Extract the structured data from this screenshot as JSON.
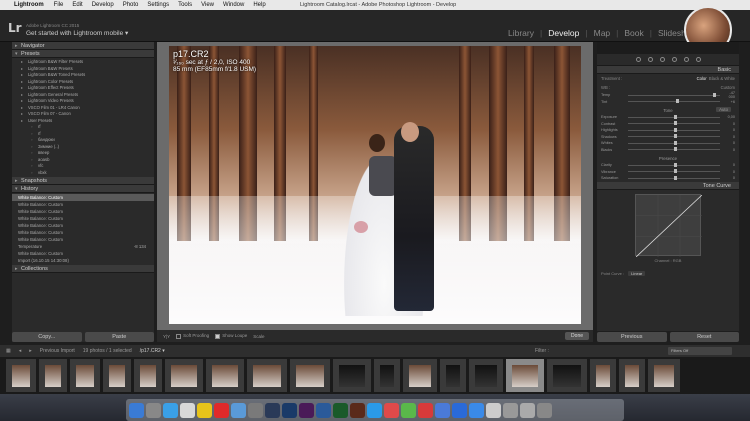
{
  "menubar": {
    "app": "Lightroom",
    "items": [
      "File",
      "Edit",
      "Develop",
      "Photo",
      "Settings",
      "Tools",
      "View",
      "Window",
      "Help"
    ],
    "window_title": "Lightroom Catalog.lrcat - Adobe Photoshop Lightroom - Develop"
  },
  "identity": {
    "logo": "Lr",
    "version": "Adobe Lightroom CC 2015",
    "tagline": "Get started with Lightroom mobile ▾"
  },
  "modules": {
    "items": [
      "Library",
      "Develop",
      "Map",
      "Book",
      "Slideshow"
    ],
    "active": "Develop"
  },
  "left_panel": {
    "navigator": "Navigator",
    "presets_header": "Presets",
    "presets": [
      "Lightroom B&W Filter Presets",
      "Lightroom B&W Presets",
      "Lightroom B&W Toned Presets",
      "Lightroom Color Presets",
      "Lightroom Effect Presets",
      "Lightroom General Presets",
      "Lightroom Video Presets",
      "VSCO Film 01 - LR4 Canon",
      "VSCO Film 07 - Canon",
      "User Presets"
    ],
    "user_presets": [
      "rf",
      "rf",
      "бандюки",
      "Зимние (..)",
      "ввеер",
      "aoasb",
      "vfc",
      "vbxk"
    ],
    "snapshots": "Snapshots",
    "history_header": "History",
    "history": [
      {
        "label": "White Balance: Custom",
        "value": ""
      },
      {
        "label": "White Balance: Custom",
        "value": ""
      },
      {
        "label": "White Balance: Custom",
        "value": ""
      },
      {
        "label": "White Balance: Custom",
        "value": ""
      },
      {
        "label": "White Balance: Custom",
        "value": ""
      },
      {
        "label": "White Balance: Custom",
        "value": ""
      },
      {
        "label": "White Balance: Custom",
        "value": ""
      },
      {
        "label": "Temperature",
        "value": "-8   134"
      },
      {
        "label": "White Balance: Custom",
        "value": ""
      },
      {
        "label": "Import (16.10.15 14:30:08)",
        "value": ""
      }
    ],
    "collections": "Collections",
    "copy_label": "Copy...",
    "paste_label": "Paste"
  },
  "photo": {
    "filename": "p17.CR2",
    "exposure": "¹⁄₁₆₀ sec at ƒ / 2,0, ISO 400",
    "lens": "85 mm (EF85mm f/1.8 USM)"
  },
  "toolbar": {
    "before_after": "Y|Y",
    "soft_proofing": "Soft Proofing",
    "show_loupe": "Show Loupe",
    "zoom_label": "Scale",
    "done": "Done"
  },
  "right_panel": {
    "basic_header": "Basic",
    "treatment_label": "Treatment :",
    "treatment_color": "Color",
    "treatment_bw": "Black & White",
    "wb_label": "WB :",
    "wb_value": "Custom",
    "temp_label": "Temp",
    "temp_value": "-47 000",
    "tint_label": "Tint",
    "tint_value": "+6",
    "tone_header": "Tone",
    "tone_auto": "Auto",
    "tone_sliders": [
      {
        "label": "Exposure",
        "value": "0,00",
        "level": 0.5
      },
      {
        "label": "Contrast",
        "value": "0",
        "level": 0.5
      },
      {
        "label": "Highlights",
        "value": "0",
        "level": 0.5
      },
      {
        "label": "Shadows",
        "value": "0",
        "level": 0.5
      },
      {
        "label": "Whites",
        "value": "0",
        "level": 0.5
      },
      {
        "label": "Blacks",
        "value": "0",
        "level": 0.5
      }
    ],
    "presence_header": "Presence",
    "presence_sliders": [
      {
        "label": "Clarity",
        "value": "0",
        "level": 0.5
      },
      {
        "label": "Vibrance",
        "value": "0",
        "level": 0.5
      },
      {
        "label": "Saturation",
        "value": "0",
        "level": 0.5
      }
    ],
    "tone_curve_header": "Tone Curve",
    "curve_info": "Channel :   RGB",
    "point_curve_label": "Point Curve :",
    "point_curve_value": "Linear",
    "previous_label": "Previous",
    "reset_label": "Reset"
  },
  "filmstrip": {
    "previous_import": "Previous Import",
    "count": "19 photos / 1 selected",
    "selected_file": "/p17.CR2 ▾",
    "filter_label": "Filter :",
    "filter_value": "Filters Off",
    "thumb_count": 19
  }
}
